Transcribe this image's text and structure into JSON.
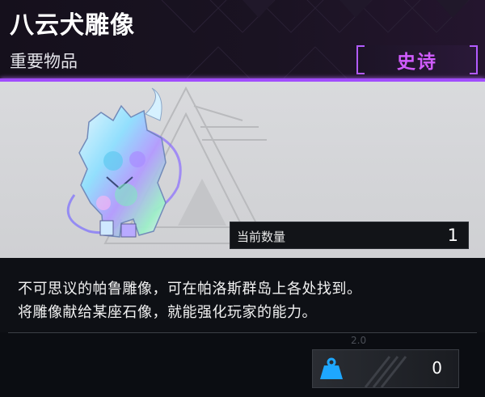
{
  "item": {
    "name": "八云犬雕像",
    "category": "重要物品",
    "rarity": "史诗"
  },
  "quantity": {
    "label": "当前数量",
    "value": "1"
  },
  "description": {
    "lines": [
      "不可思议的帕鲁雕像，可在帕洛斯群岛上各处找到。",
      "将雕像献给某座石像，就能强化玩家的能力。"
    ]
  },
  "footer": {
    "version": "2.0",
    "weight_icon": "weight-icon",
    "weight_value": "0"
  },
  "colors": {
    "rarity_accent": "#a04cff",
    "rarity_text": "#d15cff",
    "weight_icon": "#1ea7ff"
  }
}
